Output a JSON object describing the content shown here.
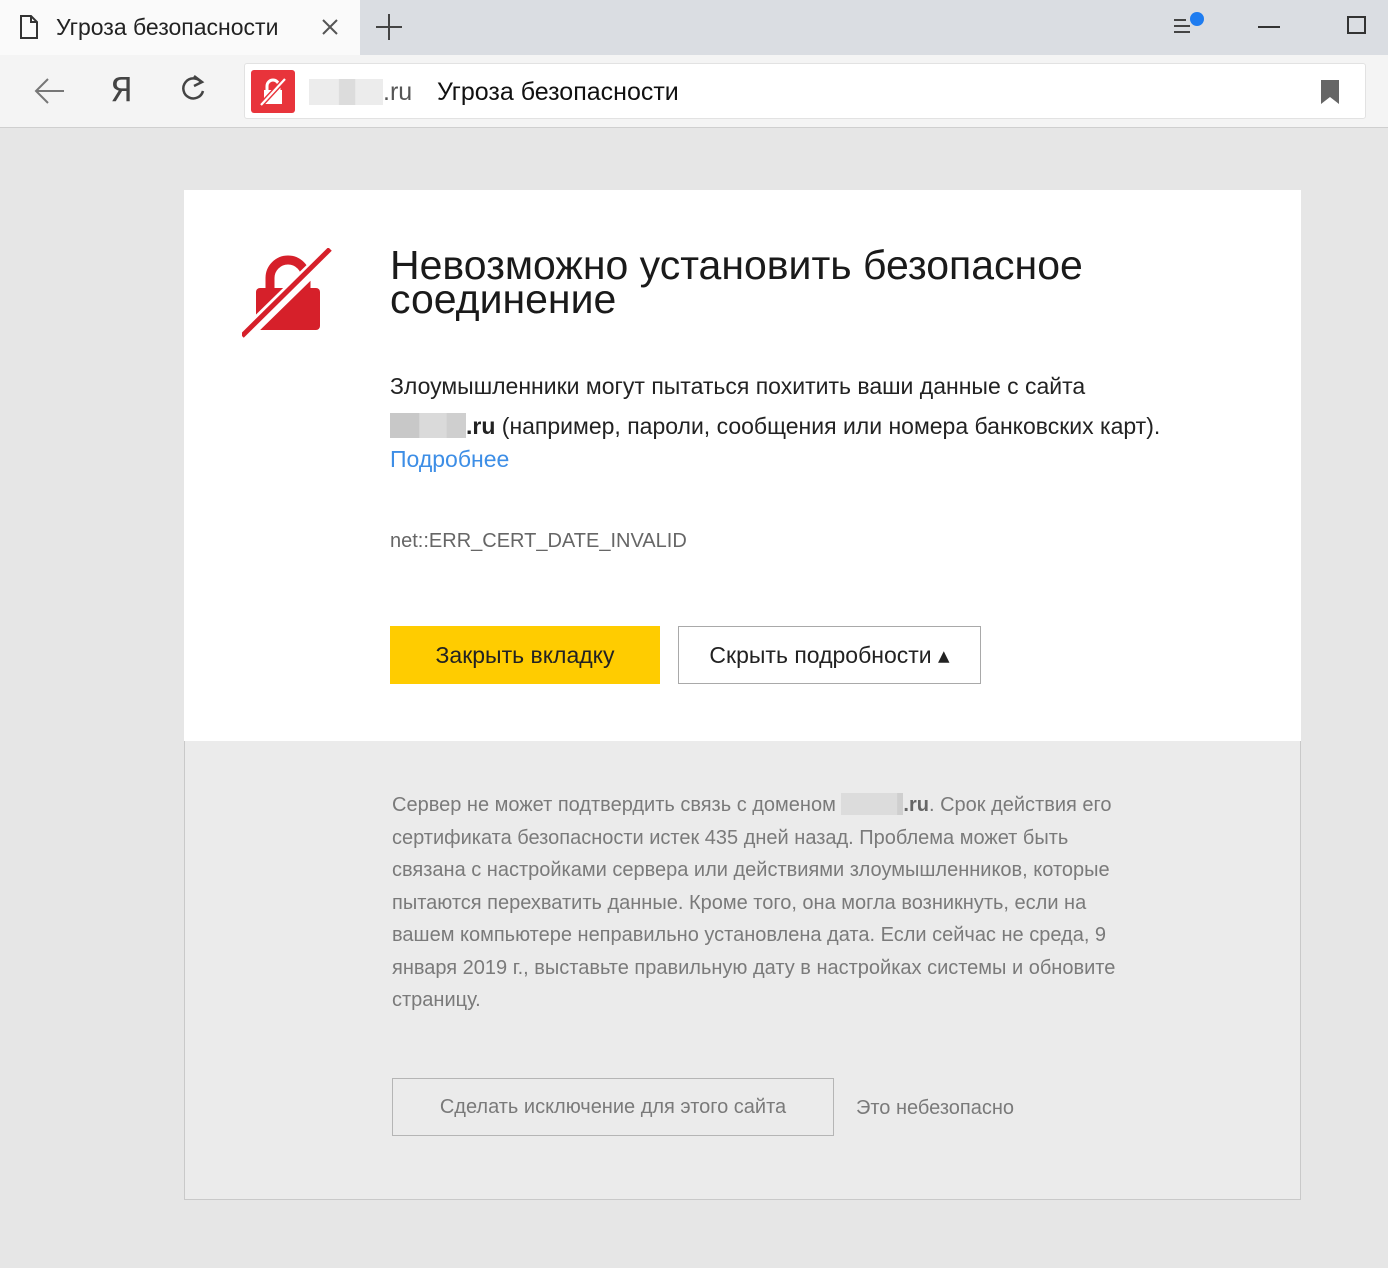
{
  "tab": {
    "title": "Угроза безопасности"
  },
  "address_bar": {
    "domain_suffix": ".ru",
    "page_title": "Угроза безопасности"
  },
  "toolbar": {
    "yandex_button": "Я"
  },
  "error": {
    "headline_line1": "Невозможно установить безопасное",
    "headline_line2": "соединение",
    "desc_part1": "Злоумышленники могут пытаться похитить ваши данные с сайта",
    "desc_domain": ".ru",
    "desc_part2": " (например, пароли, сообщения или номера банковских карт).",
    "more_link": "Подробнее",
    "code": "net::ERR_CERT_DATE_INVALID",
    "close_tab_button": "Закрыть вкладку",
    "hide_details_button": "Скрыть подробности ▴"
  },
  "details": {
    "text_part1": "Сервер не может подтвердить связь с доменом ",
    "domain": ".ru",
    "text_part2": ". Срок действия его сертификата безопасности истек 435 дней назад. Проблема может быть связана с настройками сервера или действиями злоумышленников, которые пытаются перехватить данные. Кроме того, она могла возникнуть, если на вашем компьютере неправильно установлена дата. Если сейчас не среда, 9 января 2019 г., выставьте правильную дату в настройках системы и обновите страницу.",
    "exception_button": "Сделать исключение для этого сайта",
    "unsafe_label": "Это небезопасно"
  },
  "colors": {
    "accent_yellow": "#ffcc00",
    "danger_red": "#e8343b",
    "link_blue": "#3d8ee6"
  },
  "icons": [
    "document-icon",
    "tab-close-icon",
    "new-tab-icon",
    "menu-icon",
    "notification-dot-icon",
    "minimize-icon",
    "maximize-icon",
    "back-arrow-icon",
    "reload-icon",
    "broken-lock-icon",
    "bookmark-icon"
  ]
}
